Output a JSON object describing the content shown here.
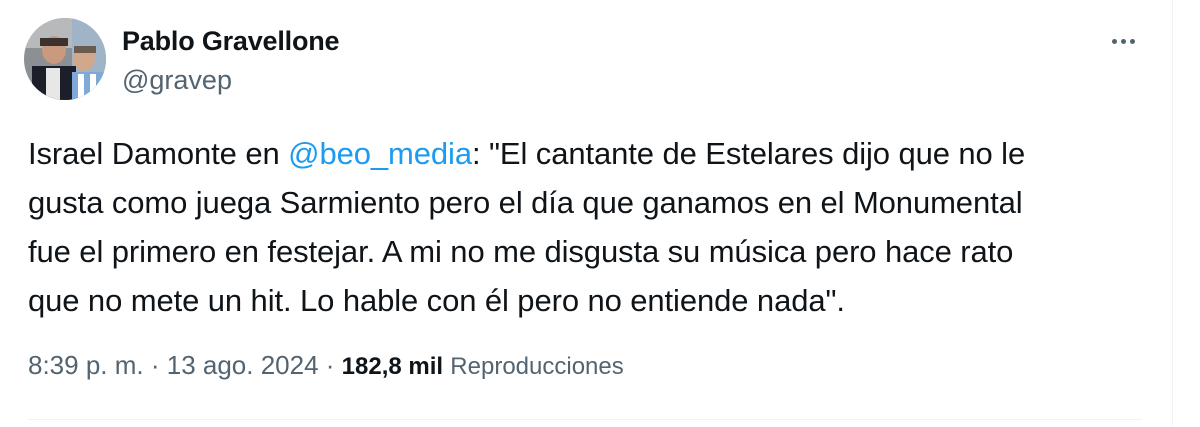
{
  "author": {
    "name": "Pablo Gravellone",
    "handle": "@gravep"
  },
  "more_icon": "more-horizontal-icon",
  "tweet": {
    "line1_pre": "Israel Damonte en ",
    "mention": "@beo_media",
    "line1_post": ": \"El cantante de Estelares dijo que no le",
    "line2": "gusta como juega Sarmiento pero el día que ganamos en el Monumental",
    "line3": "fue el primero en festejar. A mi no me  disgusta su música pero hace rato",
    "line4": "que no mete un hit. Lo hable con él pero no entiende nada\"."
  },
  "meta": {
    "time": "8:39 p. m.",
    "sep1": " · ",
    "date": "13 ago. 2024",
    "sep2": " · ",
    "views_count": "182,8 mil",
    "views_label": "Reproducciones"
  },
  "colors": {
    "text": "#0f1419",
    "secondary": "#536471",
    "link": "#1d9bf0",
    "border": "#eff3f4"
  }
}
